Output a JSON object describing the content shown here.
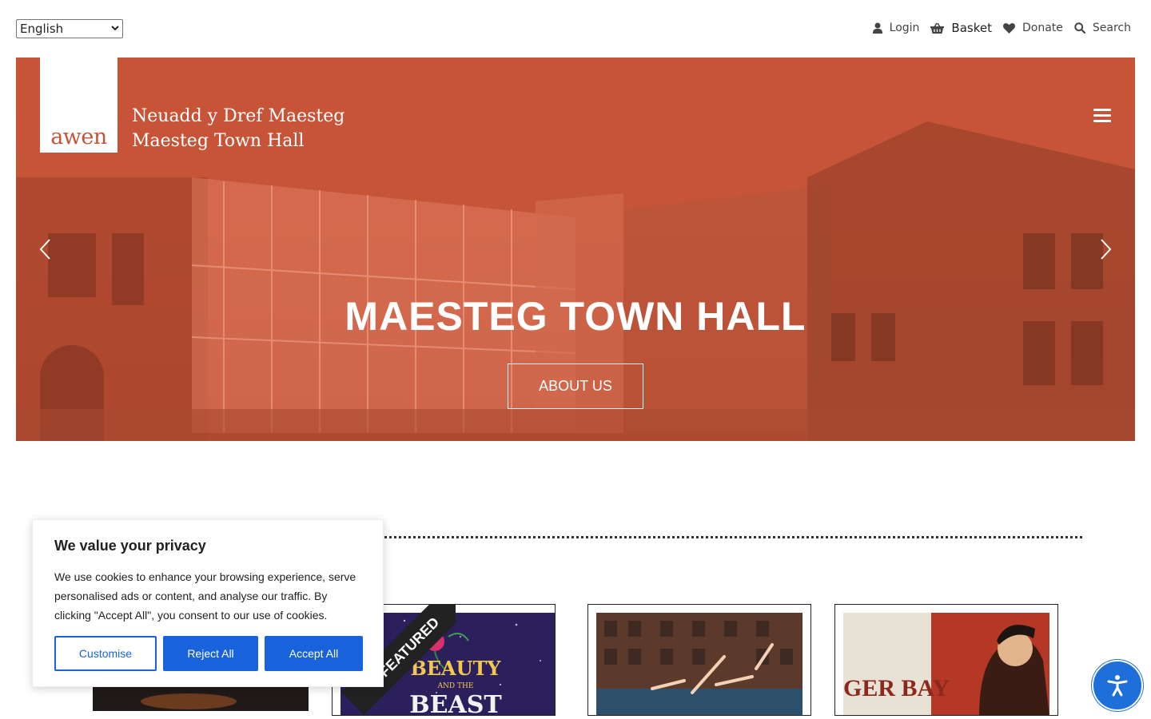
{
  "language": {
    "selected": "English"
  },
  "utility_nav": {
    "login": "Login",
    "basket": "Basket",
    "donate": "Donate",
    "search": "Search"
  },
  "hero": {
    "logo_text": "awen",
    "venue_line1": "Neuadd y Dref  Maesteg",
    "venue_line2": "Maesteg Town Hall",
    "title": "MAESTEG TOWN HALL",
    "button_label": "ABOUT US"
  },
  "featured": {
    "ribbon_label": "FEATURED",
    "cards": [
      {
        "art_text": ""
      },
      {
        "art_text": "BEAUTY"
      },
      {
        "art_text": ""
      },
      {
        "art_text": "GER BAY"
      }
    ]
  },
  "cookie_banner": {
    "title": "We value your privacy",
    "body": "We use cookies to enhance your browsing experience, serve personalised ads or content, and analyse our traffic. By clicking \"Accept All\", you consent to our use of cookies.",
    "customise": "Customise",
    "reject": "Reject All",
    "accept": "Accept All"
  },
  "colors": {
    "hero_overlay": "#c85437",
    "cookie_primary": "#1863dc",
    "accessibility_button": "#1e6fd9"
  },
  "icons": [
    "user-icon",
    "basket-icon",
    "heart-icon",
    "search-icon",
    "hamburger-icon",
    "chevron-left-icon",
    "chevron-right-icon",
    "accessibility-icon"
  ]
}
